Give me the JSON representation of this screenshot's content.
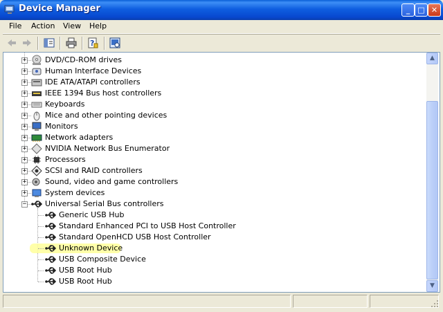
{
  "window": {
    "title": "Device Manager"
  },
  "title_buttons": {
    "minimize": "_",
    "maximize": "□",
    "close": "✕"
  },
  "menu": [
    "File",
    "Action",
    "View",
    "Help"
  ],
  "toolbar": [
    "back-icon",
    "forward-icon",
    "show-hide-tree-icon",
    "print-icon",
    "help-properties-icon",
    "scan-hardware-icon"
  ],
  "tree": {
    "categories": [
      {
        "label": "DVD/CD-ROM drives",
        "icon": "dvd-drive-icon",
        "expander": "+"
      },
      {
        "label": "Human Interface Devices",
        "icon": "hid-icon",
        "expander": "+"
      },
      {
        "label": "IDE ATA/ATAPI controllers",
        "icon": "ide-controller-icon",
        "expander": "+"
      },
      {
        "label": "IEEE 1394 Bus host controllers",
        "icon": "ieee1394-icon",
        "expander": "+"
      },
      {
        "label": "Keyboards",
        "icon": "keyboard-icon",
        "expander": "+"
      },
      {
        "label": "Mice and other pointing devices",
        "icon": "mouse-icon",
        "expander": "+"
      },
      {
        "label": "Monitors",
        "icon": "monitor-icon",
        "expander": "+"
      },
      {
        "label": "Network adapters",
        "icon": "network-adapter-icon",
        "expander": "+"
      },
      {
        "label": "NVIDIA Network Bus Enumerator",
        "icon": "nvidia-bus-icon",
        "expander": "+"
      },
      {
        "label": "Processors",
        "icon": "processor-icon",
        "expander": "+"
      },
      {
        "label": "SCSI and RAID controllers",
        "icon": "scsi-icon",
        "expander": "+"
      },
      {
        "label": "Sound, video and game controllers",
        "icon": "sound-icon",
        "expander": "+"
      },
      {
        "label": "System devices",
        "icon": "system-devices-icon",
        "expander": "+"
      },
      {
        "label": "Universal Serial Bus controllers",
        "icon": "usb-icon",
        "expander": "−"
      }
    ],
    "usb_children": [
      {
        "label": "Generic USB Hub",
        "icon": "usb-icon"
      },
      {
        "label": "Standard Enhanced PCI to USB Host Controller",
        "icon": "usb-icon"
      },
      {
        "label": "Standard OpenHCD USB Host Controller",
        "icon": "usb-icon"
      },
      {
        "label": "Unknown Device",
        "icon": "usb-icon",
        "highlighted": true
      },
      {
        "label": "USB Composite Device",
        "icon": "usb-icon"
      },
      {
        "label": "USB Root Hub",
        "icon": "usb-icon"
      },
      {
        "label": "USB Root Hub",
        "icon": "usb-icon"
      }
    ]
  },
  "scrollbar": {
    "up": "▲",
    "down": "▼"
  },
  "colors": {
    "titlebar": "#0A5FD8",
    "highlight": "#FFFF9A",
    "chrome": "#ECE9D8"
  }
}
